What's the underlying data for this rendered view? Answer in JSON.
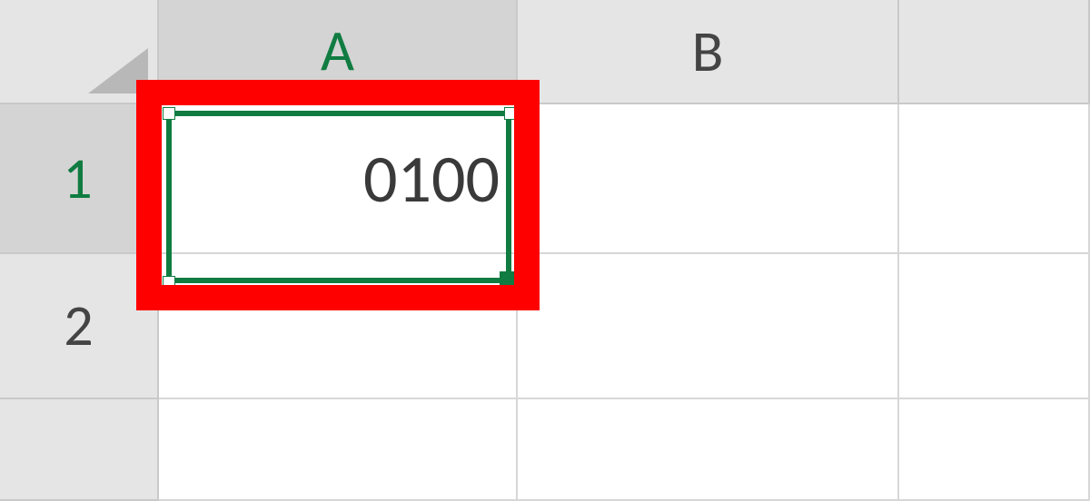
{
  "colors": {
    "selection": "#107c41",
    "annotation": "#ff0000",
    "header_bg": "#e5e5e5",
    "header_sel_bg": "#d4d4d4",
    "cell_bg": "#ffffff",
    "grid": "#d7d7d7"
  },
  "columns": [
    {
      "id": "A",
      "label": "A",
      "selected": true
    },
    {
      "id": "B",
      "label": "B",
      "selected": false
    },
    {
      "id": "C",
      "label": "",
      "selected": false
    }
  ],
  "rows": [
    {
      "id": "1",
      "label": "1",
      "selected": true
    },
    {
      "id": "2",
      "label": "2",
      "selected": false
    },
    {
      "id": "3",
      "label": "",
      "selected": false
    }
  ],
  "cells": {
    "A1": {
      "value": "0100",
      "selected": true
    },
    "B1": {
      "value": ""
    },
    "A2": {
      "value": ""
    },
    "B2": {
      "value": ""
    }
  },
  "active_cell": "A1",
  "annotation_target": "A1"
}
